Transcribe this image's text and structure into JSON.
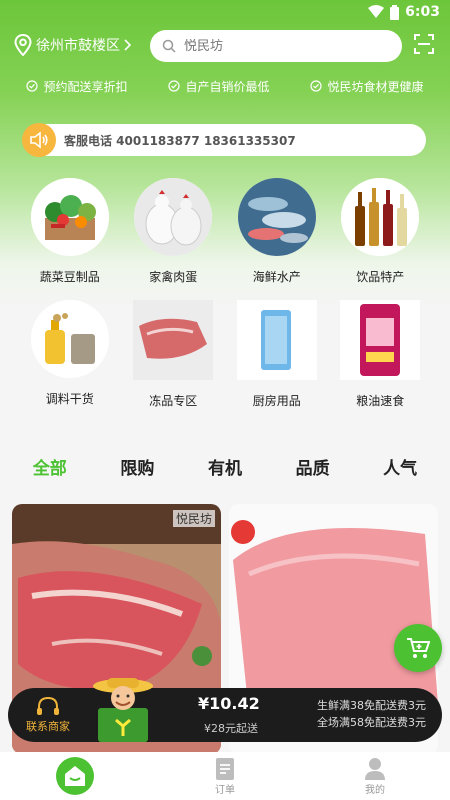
{
  "status_bar": {
    "time": "6:03"
  },
  "header": {
    "location": "徐州市鼓楼区",
    "search_placeholder": "悦民坊"
  },
  "promos": [
    {
      "label": "预约配送享折扣"
    },
    {
      "label": "自产自销价最低"
    },
    {
      "label": "悦民坊食材更健康"
    }
  ],
  "notice": {
    "text": "客服电话 4001183877 18361335307"
  },
  "categories": [
    {
      "label": "蔬菜豆制品",
      "icon": "vegetable-basket"
    },
    {
      "label": "家禽肉蛋",
      "icon": "poultry"
    },
    {
      "label": "海鲜水产",
      "icon": "seafood"
    },
    {
      "label": "饮品特产",
      "icon": "bottles"
    },
    {
      "label": "调料干货",
      "icon": "seasoning"
    },
    {
      "label": "冻品专区",
      "icon": "frozen-meat"
    },
    {
      "label": "厨房用品",
      "icon": "kitchen-package"
    },
    {
      "label": "粮油速食",
      "icon": "rice-bag"
    }
  ],
  "tabs": [
    {
      "label": "全部",
      "active": true
    },
    {
      "label": "限购"
    },
    {
      "label": "有机"
    },
    {
      "label": "品质"
    },
    {
      "label": "人气"
    }
  ],
  "products": [
    {
      "logo": "悦民坊"
    },
    {
      "logo": ""
    }
  ],
  "cart_bar": {
    "contact_label": "联系商家",
    "price": "¥10.42",
    "min_order": "¥28元起送",
    "ship_line1": "生鲜满38免配送费3元",
    "ship_line2": "全场满58免配送费3元"
  },
  "bottom_nav": [
    {
      "label": ""
    },
    {
      "label": "订单"
    },
    {
      "label": "我的"
    }
  ],
  "colors": {
    "accent": "#4cc232",
    "notice_icon": "#f7b63d",
    "cart_bar": "#1c1c1c"
  }
}
